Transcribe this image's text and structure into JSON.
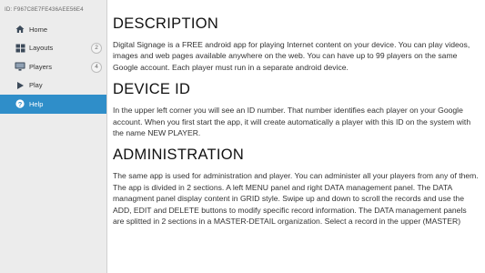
{
  "sidebar": {
    "device_id": "ID: F967C8E7FE436AEE56E4",
    "items": [
      {
        "label": "Home",
        "icon": "home-icon",
        "badge": ""
      },
      {
        "label": "Layouts",
        "icon": "layouts-icon",
        "badge": "2"
      },
      {
        "label": "Players",
        "icon": "monitor-icon",
        "badge": "4"
      },
      {
        "label": "Play",
        "icon": "play-icon",
        "badge": ""
      },
      {
        "label": "Help",
        "icon": "help-icon",
        "badge": "",
        "active": true
      }
    ],
    "active_color": "#2f8ec9"
  },
  "main": {
    "sections": [
      {
        "heading": "DESCRIPTION",
        "body": "Digital Signage is a FREE android app for playing Internet content on your device. You can play videos, images and web pages available anywhere on the web. You can have up to 99 players on the same Google account. Each player must run in a separate android device."
      },
      {
        "heading": "DEVICE ID",
        "body": "In the upper left corner you will see an ID number. That number identifies each player on your Google account. When you first start the app, it will create automatically a player with this ID on the system with the name NEW PLAYER."
      },
      {
        "heading": "ADMINISTRATION",
        "body": "The same app is used for administration and player. You can administer all your players from any of them. The app is divided in 2 sections. A left MENU panel and right DATA management panel. The DATA managment panel display content in GRID style. Swipe up and down to scroll the records and use the ADD, EDIT and DELETE buttons to modify specific record information. The DATA management panels are splitted in 2 sections in a MASTER-DETAIL organization. Select a record in the upper (MASTER)"
      }
    ]
  }
}
